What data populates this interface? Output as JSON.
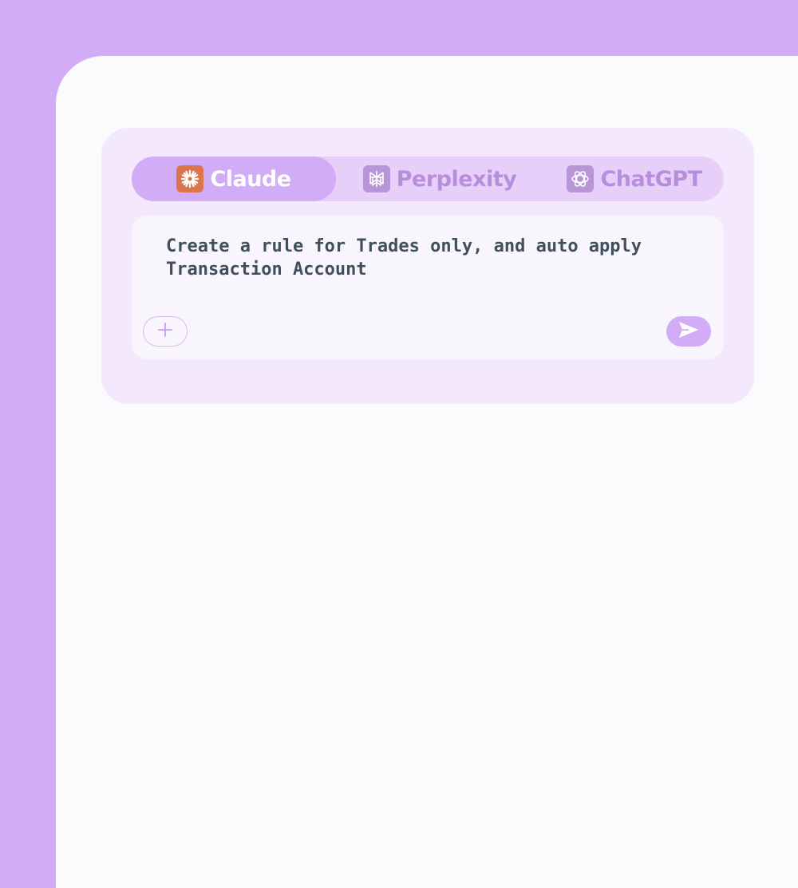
{
  "tabs": [
    {
      "label": "Claude",
      "icon": "claude-sparkle-icon",
      "active": true
    },
    {
      "label": "Perplexity",
      "icon": "perplexity-icon",
      "active": false
    },
    {
      "label": "ChatGPT",
      "icon": "chatgpt-icon",
      "active": false
    }
  ],
  "prompt": {
    "text": "Create a rule for Trades only, and auto apply\nTransaction Account"
  },
  "colors": {
    "background": "#d2acf7",
    "panel": "#fafbfd",
    "card": "#f4e8fd",
    "tab_bar": "#e6cff9",
    "active_tab": "#d2acf7",
    "inactive_tab_text": "#b78edb",
    "claude_icon_bg": "#d9754f",
    "prompt_text": "#3f4f5b"
  }
}
